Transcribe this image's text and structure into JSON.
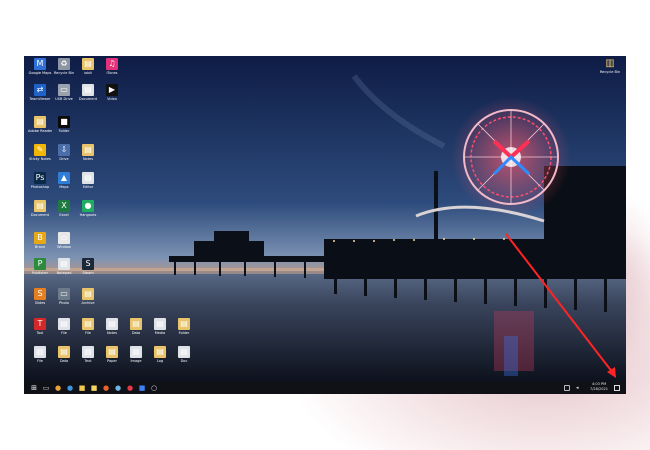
{
  "desktop": {
    "icons": [
      {
        "label": "Google Maps",
        "glyph": "M",
        "color": "#2f6fd6"
      },
      {
        "label": "Recycle Bin",
        "glyph": "♻",
        "color": "#8b95a3"
      },
      {
        "label": "iobit",
        "glyph": "▤",
        "color": "#e9c46a"
      },
      {
        "label": "iTunes",
        "glyph": "♫",
        "color": "#e2327a"
      },
      {
        "label": "TeamViewer",
        "glyph": "⇄",
        "color": "#1f63c9"
      },
      {
        "label": "USB Drive",
        "glyph": "▭",
        "color": "#9aa3ad"
      },
      {
        "label": "Document",
        "glyph": "▤",
        "color": "#dfe3e8"
      },
      {
        "label": "Video",
        "glyph": "▶",
        "color": "#111111"
      },
      {
        "label": "Adobe Reader",
        "glyph": "▤",
        "color": "#e9c46a"
      },
      {
        "label": "Folder",
        "glyph": "■",
        "color": "#0b0b0b"
      },
      {
        "label": "Sticky Notes",
        "glyph": "✎",
        "color": "#f2b705"
      },
      {
        "label": "Drive",
        "glyph": "⇩",
        "color": "#4b6ea9"
      },
      {
        "label": "Notes",
        "glyph": "▤",
        "color": "#e9c46a"
      },
      {
        "label": "Photoshop",
        "glyph": "Ps",
        "color": "#0b2a4a"
      },
      {
        "label": "Maps",
        "glyph": "▲",
        "color": "#2f7dd6"
      },
      {
        "label": "Editor",
        "glyph": "▤",
        "color": "#dfe3e8"
      },
      {
        "label": "Document",
        "glyph": "▤",
        "color": "#e9c46a"
      },
      {
        "label": "Excel",
        "glyph": "X",
        "color": "#1f7a3f"
      },
      {
        "label": "Hangouts",
        "glyph": "●",
        "color": "#1fae62"
      },
      {
        "label": "Brave",
        "glyph": "B",
        "color": "#e6a817"
      },
      {
        "label": "Window",
        "glyph": "▭",
        "color": "#e8e8e8"
      },
      {
        "label": "Publisher",
        "glyph": "P",
        "color": "#2e8b3d"
      },
      {
        "label": "Notepad",
        "glyph": "▤",
        "color": "#dfe3e8"
      },
      {
        "label": "Steam",
        "glyph": "S",
        "color": "#1b2838"
      },
      {
        "label": "Slides",
        "glyph": "S",
        "color": "#e67e22"
      },
      {
        "label": "Photo",
        "glyph": "▭",
        "color": "#6c7a89"
      },
      {
        "label": "Archive",
        "glyph": "▤",
        "color": "#e9c46a"
      },
      {
        "label": "Tool",
        "glyph": "T",
        "color": "#d62828"
      },
      {
        "label": "File",
        "glyph": "▤",
        "color": "#dfe3e8"
      },
      {
        "label": "File",
        "glyph": "▤",
        "color": "#e9c46a"
      },
      {
        "label": "Notes",
        "glyph": "▤",
        "color": "#dfe3e8"
      },
      {
        "label": "Data",
        "glyph": "▤",
        "color": "#e9c46a"
      },
      {
        "label": "Media",
        "glyph": "▤",
        "color": "#dfe3e8"
      },
      {
        "label": "Folder",
        "glyph": "▤",
        "color": "#e9c46a"
      },
      {
        "label": "File",
        "glyph": "▤",
        "color": "#dfe3e8"
      },
      {
        "label": "Data",
        "glyph": "▤",
        "color": "#e9c46a"
      },
      {
        "label": "Text",
        "glyph": "▤",
        "color": "#dfe3e8"
      },
      {
        "label": "Paper",
        "glyph": "▤",
        "color": "#e9c46a"
      },
      {
        "label": "Image",
        "glyph": "▤",
        "color": "#dfe3e8"
      },
      {
        "label": "Log",
        "glyph": "▤",
        "color": "#e9c46a"
      },
      {
        "label": "Doc",
        "glyph": "▤",
        "color": "#dfe3e8"
      }
    ],
    "recycle_bin": {
      "label": "Recycle Bin",
      "glyph": "▥",
      "color": "#e9c46a"
    }
  },
  "taskbar": {
    "apps": [
      {
        "name": "start-icon",
        "glyph": "⊞",
        "color": "#ffffff"
      },
      {
        "name": "task-view-icon",
        "glyph": "▭",
        "color": "#cccccc"
      },
      {
        "name": "chrome-icon",
        "glyph": "●",
        "color": "#e9a23b"
      },
      {
        "name": "edge-icon",
        "glyph": "●",
        "color": "#3a96dd"
      },
      {
        "name": "file-explorer-icon",
        "glyph": "■",
        "color": "#f2c94c"
      },
      {
        "name": "sticky-notes-icon",
        "glyph": "■",
        "color": "#f4d35e"
      },
      {
        "name": "firefox-icon",
        "glyph": "●",
        "color": "#e8622b"
      },
      {
        "name": "paint-icon",
        "glyph": "●",
        "color": "#6fb3e0"
      },
      {
        "name": "app-icon",
        "glyph": "●",
        "color": "#e63946"
      },
      {
        "name": "search-app-icon",
        "glyph": "■",
        "color": "#3d82f0"
      },
      {
        "name": "cortana-icon",
        "glyph": "○",
        "color": "#dddddd"
      }
    ],
    "clock_time": "4:03 PM",
    "clock_date": "7/28/2021"
  }
}
